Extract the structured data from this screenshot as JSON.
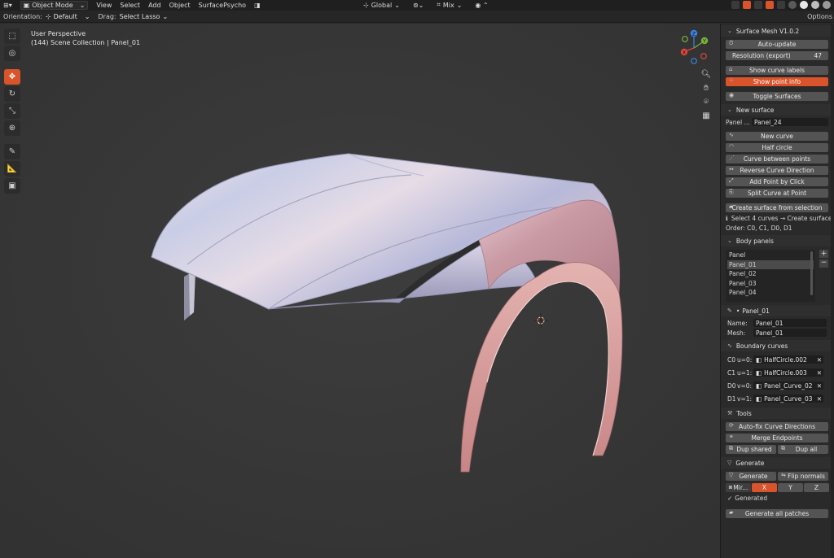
{
  "header": {
    "mode": "Object Mode",
    "menus": [
      "View",
      "Select",
      "Add",
      "Object",
      "SurfacePsycho"
    ],
    "transform_orientation": "Global",
    "pivot": "Mix"
  },
  "tool_settings": {
    "orientation_label": "Orientation:",
    "orientation_value": "Default",
    "drag_label": "Drag:",
    "drag_value": "Select Lasso",
    "options_label": "Options"
  },
  "viewport": {
    "view_name": "User Perspective",
    "collection_info": "(144) Scene Collection | Panel_01",
    "gizmo_axes": [
      "Z",
      "Y",
      "X"
    ]
  },
  "sidebar": {
    "addon_title": "Surface Mesh V1.0.2",
    "auto_update": "Auto-update",
    "resolution_label": "Resolution (export)",
    "resolution_value": "47",
    "show_curve_labels": "Show curve labels",
    "show_point_info": "Show point info",
    "toggle_surfaces": "Toggle Surfaces",
    "new_surface_section": "New surface",
    "panel_label": "Panel ...",
    "panel_value": "Panel_24",
    "new_curve": "New curve",
    "half_circle": "Half circle",
    "curve_between_points": "Curve between points",
    "reverse_curve_direction": "Reverse Curve Direction",
    "add_point_by_click": "Add Point by Click",
    "split_curve_at_point": "Split Curve at Point",
    "create_surface_from_selection": "Create surface from selection",
    "select_hint": "Select 4 curves → Create surface",
    "order_text": "Order: C0, C1, D0, D1",
    "body_panels_section": "Body panels",
    "panel_list": [
      "Panel",
      "Panel_01",
      "Panel_02",
      "Panel_03",
      "Panel_04"
    ],
    "selected_panel_title": "Panel_01",
    "name_label": "Name:",
    "name_value": "Panel_01",
    "mesh_label": "Mesh:",
    "mesh_value": "Panel_01",
    "boundary_curves_section": "Boundary curves",
    "boundary_curves": [
      {
        "key": "C0",
        "param": "u=0:",
        "value": "HalfCircle.002"
      },
      {
        "key": "C1",
        "param": "u=1:",
        "value": "HalfCircle.003"
      },
      {
        "key": "D0",
        "param": "v=0:",
        "value": "Panel_Curve_02"
      },
      {
        "key": "D1",
        "param": "v=1:",
        "value": "Panel_Curve_03"
      }
    ],
    "tools_section": "Tools",
    "auto_fix": "Auto-fix Curve Directions",
    "merge_endpoints": "Merge Endpoints",
    "dup_shared": "Dup shared",
    "dup_all": "Dup all",
    "generate_section": "Generate",
    "generate_btn": "Generate",
    "flip_normals": "Flip normals",
    "mirror_label": "Mir...",
    "axis_x": "X",
    "axis_y": "Y",
    "axis_z": "Z",
    "generated_label": "Generated",
    "generate_all_patches": "Generate all patches"
  },
  "colors": {
    "accent": "#d9532b",
    "axis_x": "#e0463a",
    "axis_y": "#7ab33b",
    "axis_z": "#3a83e0"
  }
}
